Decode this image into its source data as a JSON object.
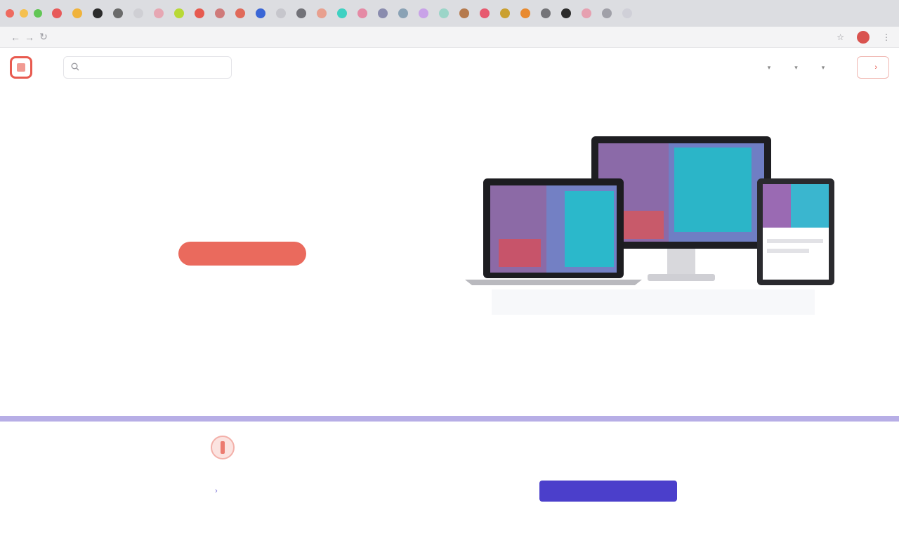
{
  "tabs": {
    "favicon_colors": [
      "#e75a5a",
      "#f0b33c",
      "#2c2c2c",
      "#6b6b6b",
      "#cfcfd4",
      "#e6a7b3",
      "#b8d936",
      "#e65a4f",
      "#cf7a7a",
      "#e06a5a",
      "#3a66d6",
      "#c6c6cc",
      "#727278",
      "#e8a08f",
      "#3fd1c2",
      "#e58aa5",
      "#8a8cae",
      "#8aa2b5",
      "#c9a2e8",
      "#9bd5c8",
      "#b57a4d",
      "#e75a70",
      "#caa030",
      "#e88a30",
      "#747478",
      "#2c2c2c",
      "#e6a0b0",
      "#a0a0a8",
      "#d0d0d8"
    ]
  },
  "browser": {
    "back": "←",
    "forward": "→",
    "reload": "↻",
    "url": "",
    "star": "☆",
    "menu": "⋮"
  },
  "header": {
    "logo_small": "",
    "logo_big": "",
    "search_placeholder": "",
    "nav": [
      {
        "label": ""
      },
      {
        "label": ""
      },
      {
        "label": ""
      },
      {
        "label": ""
      }
    ],
    "signup_label": ""
  },
  "hero": {
    "title": "",
    "accent": "",
    "subtitle": "",
    "cta_label": "",
    "caption_text": "",
    "caption_link": ""
  },
  "card": {
    "title": "",
    "text": "",
    "link_label": "",
    "button_label": ""
  },
  "colors": {
    "brand": "#e85a4f",
    "accent": "#5a4fc9",
    "divider": "#b7aee6",
    "button_primary": "#4b3fcb"
  }
}
